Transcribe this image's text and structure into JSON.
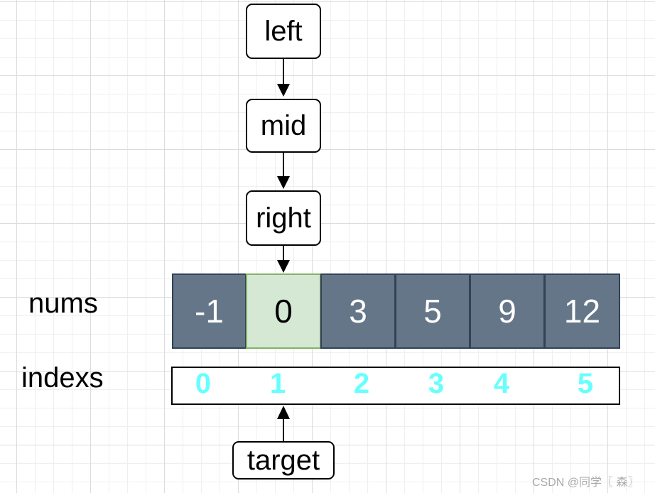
{
  "pointers": {
    "left": "left",
    "mid": "mid",
    "right": "right",
    "target": "target"
  },
  "labels": {
    "nums": "nums",
    "indexs": "indexs"
  },
  "nums": [
    "-1",
    "0",
    "3",
    "5",
    "9",
    "12"
  ],
  "indexes": [
    "0",
    "1",
    "2",
    "3",
    "4",
    "5"
  ],
  "highlighted_index": 1,
  "colors": {
    "cell": "#647687",
    "highlight": "#d5e8d4",
    "index_text": "#66ffff"
  },
  "watermark": "CSDN @同学〖 森〗"
}
